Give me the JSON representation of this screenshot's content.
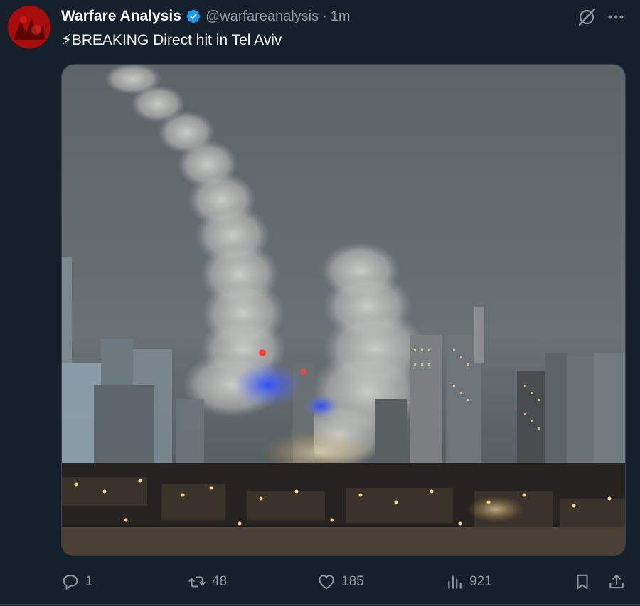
{
  "author": {
    "display_name": "Warfare Analysis",
    "handle": "@warfareanalysis",
    "separator": "·",
    "time": "1m",
    "avatar_icon": "avatar-image",
    "verified_icon": "verified-badge-icon"
  },
  "tweet": {
    "text": "⚡BREAKING Direct hit in Tel Aviv"
  },
  "media": {
    "icon": "photo-city-night-smoke"
  },
  "actions": {
    "reply_count": "1",
    "retweet_count": "48",
    "like_count": "185",
    "view_count": "921"
  },
  "colors": {
    "background": "#15202b",
    "secondary_text": "#8b98a5",
    "verified": "#1d9bf0",
    "border": "#38444d"
  }
}
